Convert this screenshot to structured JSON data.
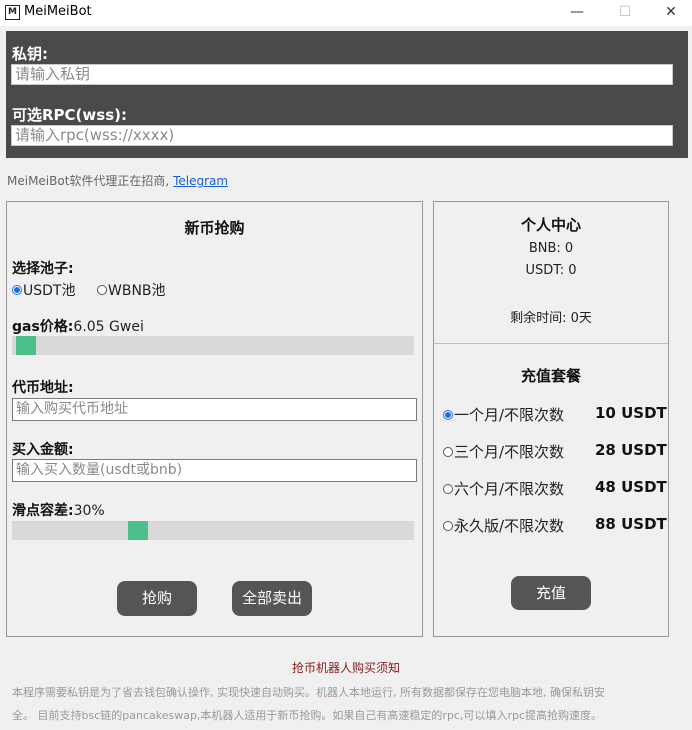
{
  "window": {
    "title": "MeiMeiBot",
    "icon": "app-logo-icon",
    "minimize": "—",
    "maximize": "☐",
    "close": "✕"
  },
  "config": {
    "private_key_label": "私钥:",
    "private_key_placeholder": "请输入私钥",
    "rpc_label": "可选RPC(wss):",
    "rpc_placeholder": "请输入rpc(wss://xxxx)"
  },
  "notice": {
    "text": "MeiMeiBot软件代理正在招商, ",
    "link": "Telegram"
  },
  "buy_panel": {
    "title": "新币抢购",
    "pool_label": "选择池子:",
    "pools": [
      {
        "label": "USDT池",
        "selected": true
      },
      {
        "label": "WBNB池",
        "selected": false
      }
    ],
    "gas_label": "gas价格:",
    "gas_value": "6.05 Gwei",
    "gas_slider_fraction": 0.0,
    "token_label": "代币地址:",
    "token_placeholder": "输入购买代币地址",
    "amount_label": "买入金额:",
    "amount_placeholder": "输入买入数量(usdt或bnb)",
    "slippage_label": "滑点容差:",
    "slippage_value": "30%",
    "slippage_fraction": 0.3,
    "buy_button": "抢购",
    "sell_all_button": "全部卖出"
  },
  "user_panel": {
    "title": "个人中心",
    "bnb": "BNB: 0",
    "usdt": "USDT: 0",
    "remaining": "剩余时间:  0天",
    "plans_title": "充值套餐",
    "plans": [
      {
        "label": "一个月/不限次数",
        "price": "10 USDT",
        "selected": true
      },
      {
        "label": "三个月/不限次数",
        "price": "28 USDT",
        "selected": false
      },
      {
        "label": "六个月/不限次数",
        "price": "48 USDT",
        "selected": false
      },
      {
        "label": "永久版/不限次数",
        "price": "88 USDT",
        "selected": false
      }
    ],
    "recharge_button": "充值"
  },
  "footer": {
    "title": "抢币机器人购买须知",
    "line1": "本程序需要私钥是为了省去钱包确认操作, 实现快速自动购买。机器人本地运行, 所有数据都保存在您电脑本地, 确保私钥安",
    "line2": "全。 目前支持bsc链的pancakeswap,本机器人适用于新币抢购。如果自己有高速稳定的rpc,可以填入rpc提高抢购速度。"
  },
  "colors": {
    "dark_panel": "#4a4a4a",
    "slider_thumb": "#4cbf8b",
    "button": "#555555",
    "link": "#1a5fd6",
    "footer_title": "#8b1a1a"
  }
}
